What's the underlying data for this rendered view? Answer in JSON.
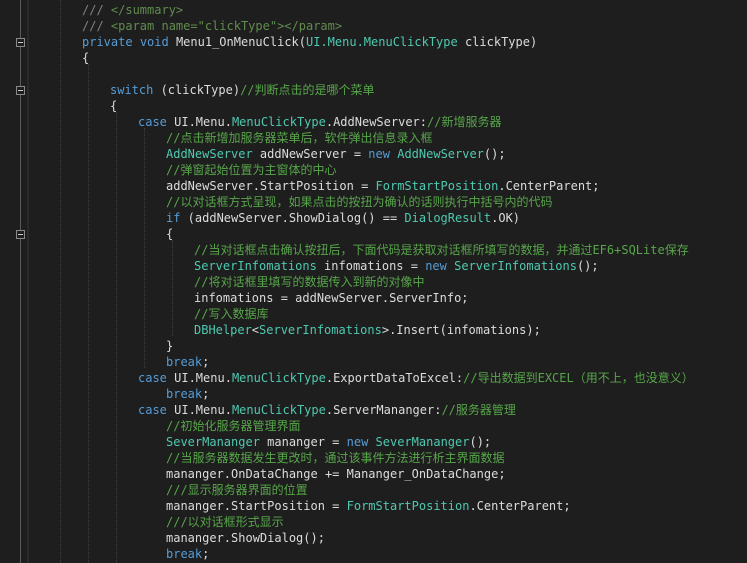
{
  "editor": {
    "language": "csharp",
    "colors": {
      "background": "#1e1e1e",
      "keyword": "#569cd6",
      "type": "#4ec9b0",
      "comment": "#57a64a",
      "string": "#d69d85",
      "text": "#dcdcdc"
    },
    "lines": {
      "l1": [
        "/// ",
        "</summary>"
      ],
      "l2": [
        "/// ",
        "<param name=\"clickType\"></param>"
      ],
      "l3": [
        "private",
        " ",
        "void",
        " Menu1_OnMenuClick(",
        "UI.Menu.MenuClickType",
        " clickType)"
      ],
      "l4": [
        "{"
      ],
      "l6": [
        "switch",
        " (clickType)",
        "//判断点击的是哪个菜单"
      ],
      "l7": [
        "{"
      ],
      "l8": [
        "case",
        " UI.Menu.",
        "MenuClickType",
        ".AddNewServer:",
        "//新增服务器"
      ],
      "l9": [
        "//点击新增加服务器菜单后，软件弹出信息录入框"
      ],
      "l10": [
        "AddNewServer",
        " addNewServer = ",
        "new",
        " ",
        "AddNewServer",
        "();"
      ],
      "l11": [
        "//弹窗起始位置为主窗体的中心"
      ],
      "l12": [
        "addNewServer.StartPosition = ",
        "FormStartPosition",
        ".CenterParent;"
      ],
      "l13": [
        "//以对话框方式呈现，如果点击的按扭为确认的话则执行中括号内的代码"
      ],
      "l14": [
        "if",
        " (addNewServer.ShowDialog() == ",
        "DialogResult",
        ".OK)"
      ],
      "l15": [
        "{"
      ],
      "l16": [
        "//当对话框点击确认按扭后，下面代码是获取对话框所填写的数据，并通过EF6+SQLite保存"
      ],
      "l17": [
        "ServerInfomations",
        " infomations = ",
        "new",
        " ",
        "ServerInfomations",
        "();"
      ],
      "l18": [
        "//将对话框里填写的数据传入到新的对像中"
      ],
      "l19": [
        "infomations = addNewServer.ServerInfo;"
      ],
      "l20": [
        "//写入数据库"
      ],
      "l21": [
        "DBHelper",
        "<",
        "ServerInfomations",
        ">.Insert(infomations);"
      ],
      "l22": [
        "}"
      ],
      "l23": [
        "break",
        ";"
      ],
      "l24": [
        "case",
        " UI.Menu.",
        "MenuClickType",
        ".ExportDataToExcel:",
        "//导出数据到EXCEL（用不上，也没意义）"
      ],
      "l25": [
        "break",
        ";"
      ],
      "l26": [
        "case",
        " UI.Menu.",
        "MenuClickType",
        ".ServerMananger:",
        "//服务器管理"
      ],
      "l27": [
        "//初始化服务器管理界面"
      ],
      "l28": [
        "SeverMananger",
        " mananger = ",
        "new",
        " ",
        "SeverMananger",
        "();"
      ],
      "l29": [
        "//当服务器数据发生更改时，通过该事件方法进行析主界面数据"
      ],
      "l30": [
        "mananger.OnDataChange += Mananger_OnDataChange;"
      ],
      "l31": [
        "///显示服务器界面的位置"
      ],
      "l32": [
        "mananger.StartPosition = ",
        "FormStartPosition",
        ".CenterParent;"
      ],
      "l33": [
        "///以对话框形式显示"
      ],
      "l34": [
        "mananger.ShowDialog();"
      ],
      "l35": [
        "break",
        ";"
      ]
    }
  }
}
